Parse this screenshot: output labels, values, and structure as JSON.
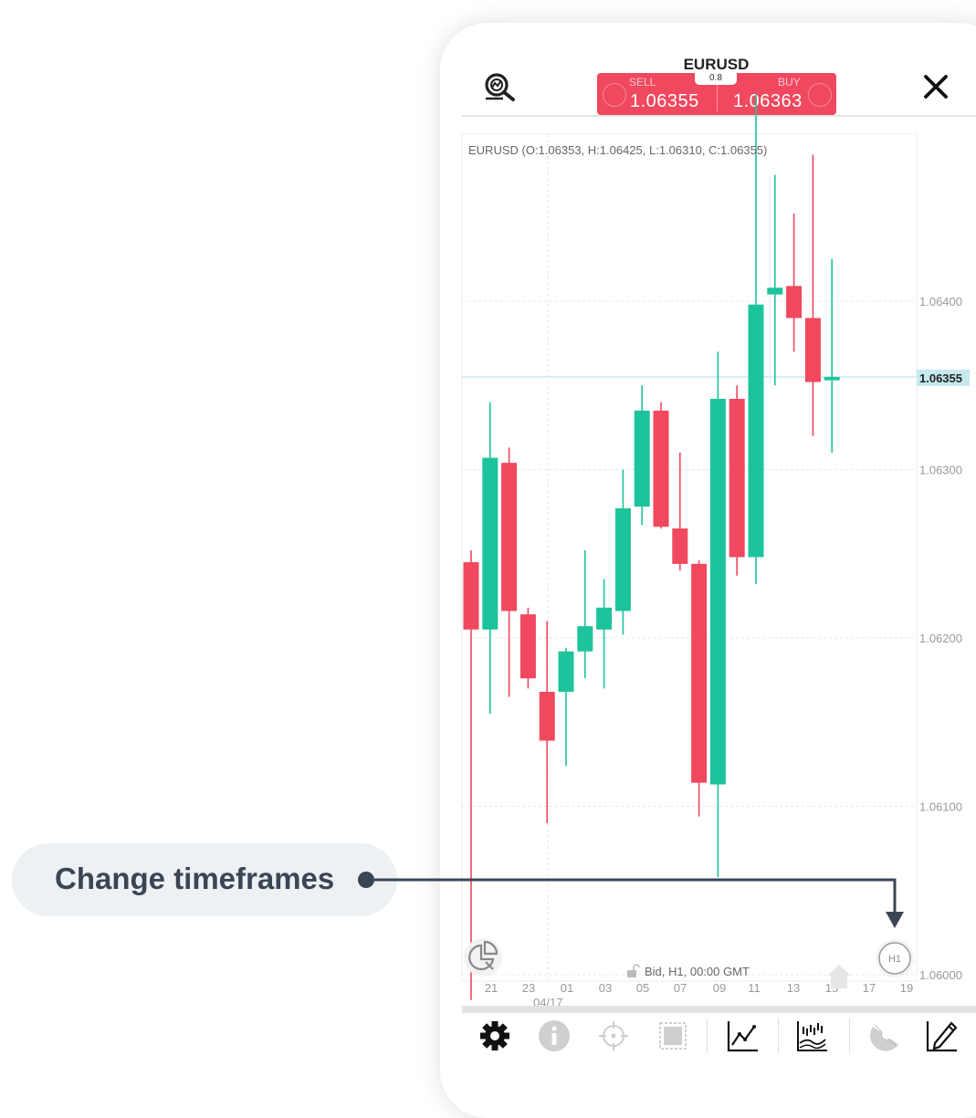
{
  "callout": {
    "label": "Change timeframes"
  },
  "header": {
    "symbol": "EURUSD",
    "spread": "0.8",
    "sell_label": "SELL",
    "buy_label": "BUY",
    "sell_price": "1.06355",
    "buy_price": "1.06363",
    "left_icon": "magnifier-chart-icon",
    "close_icon": "close-icon"
  },
  "chart_info": {
    "ohlc": "EURUSD (O:1.06353, H:1.06425, L:1.06310, C:1.06355)",
    "status": "Bid, H1, 00:00 GMT",
    "timeframe": "H1",
    "current_price": "1.06355"
  },
  "chart_data": {
    "type": "candlestick",
    "ylim": [
      1.0598,
      1.0648
    ],
    "yticks": [
      "1.06400",
      "1.06300",
      "1.06200",
      "1.06100",
      "1.06000"
    ],
    "xticks": [
      "21",
      "23",
      "01",
      "03",
      "05",
      "07",
      "09",
      "11",
      "13",
      "15",
      "17",
      "19"
    ],
    "date_label": "04/17",
    "colors": {
      "up": "#1dc49b",
      "down": "#f0485f"
    },
    "candles": [
      {
        "o": 1.06245,
        "h": 1.06252,
        "l": 1.05985,
        "c": 1.06205
      },
      {
        "o": 1.06205,
        "h": 1.0634,
        "l": 1.06155,
        "c": 1.06307
      },
      {
        "o": 1.06304,
        "h": 1.06313,
        "l": 1.06165,
        "c": 1.06216
      },
      {
        "o": 1.06214,
        "h": 1.06218,
        "l": 1.0617,
        "c": 1.06176
      },
      {
        "o": 1.06168,
        "h": 1.0621,
        "l": 1.0609,
        "c": 1.06139
      },
      {
        "o": 1.06168,
        "h": 1.06194,
        "l": 1.06124,
        "c": 1.06192
      },
      {
        "o": 1.06192,
        "h": 1.06252,
        "l": 1.06176,
        "c": 1.06207
      },
      {
        "o": 1.06205,
        "h": 1.06235,
        "l": 1.0617,
        "c": 1.06218
      },
      {
        "o": 1.06216,
        "h": 1.063,
        "l": 1.06202,
        "c": 1.06277
      },
      {
        "o": 1.06278,
        "h": 1.0635,
        "l": 1.06267,
        "c": 1.06335
      },
      {
        "o": 1.06335,
        "h": 1.0634,
        "l": 1.06265,
        "c": 1.06266
      },
      {
        "o": 1.06265,
        "h": 1.0631,
        "l": 1.0624,
        "c": 1.06244
      },
      {
        "o": 1.06244,
        "h": 1.06246,
        "l": 1.06094,
        "c": 1.06114
      },
      {
        "o": 1.06113,
        "h": 1.0637,
        "l": 1.06058,
        "c": 1.06342
      },
      {
        "o": 1.06342,
        "h": 1.0635,
        "l": 1.06237,
        "c": 1.06248
      },
      {
        "o": 1.06248,
        "h": 1.06523,
        "l": 1.06232,
        "c": 1.06398
      },
      {
        "o": 1.06404,
        "h": 1.06475,
        "l": 1.0635,
        "c": 1.06408
      },
      {
        "o": 1.06409,
        "h": 1.06452,
        "l": 1.0637,
        "c": 1.0639
      },
      {
        "o": 1.0639,
        "h": 1.06487,
        "l": 1.0632,
        "c": 1.06352
      },
      {
        "o": 1.06353,
        "h": 1.06425,
        "l": 1.0631,
        "c": 1.06355
      }
    ]
  },
  "toolbar": {
    "items": [
      {
        "icon": "gear-icon"
      },
      {
        "icon": "info-icon"
      },
      {
        "icon": "crosshair-icon"
      },
      {
        "icon": "select-area-icon"
      },
      {
        "icon": "line-chart-icon"
      },
      {
        "icon": "indicators-icon"
      },
      {
        "icon": "magnet-icon"
      },
      {
        "icon": "draw-tool-icon"
      }
    ]
  },
  "bottom_left_icon": "pie-chart-icon",
  "lock_icon": "unlock-icon"
}
